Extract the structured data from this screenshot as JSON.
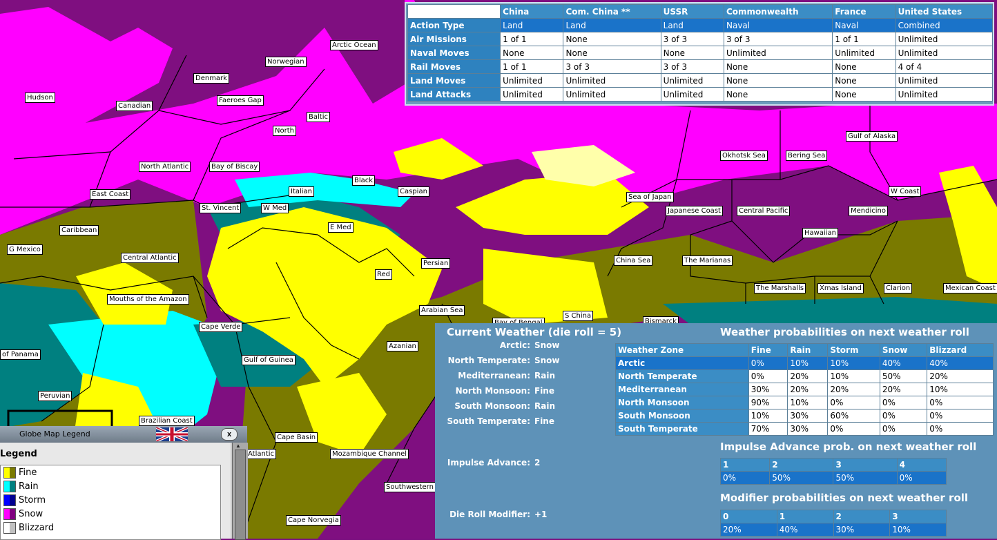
{
  "colors": {
    "fine": "#ffff00",
    "fine_dark": "#7a7a00",
    "rain": "#00ffff",
    "rain_dark": "#008080",
    "storm": "#0000ff",
    "storm_dark": "#000090",
    "snow": "#ff00ff",
    "snow_dark": "#800080",
    "blizzard": "#ffffff",
    "blizzard_dark": "#c0c0c0",
    "panel": "#5e92b8",
    "header": "#3b8dc5",
    "selected": "#1a73c9"
  },
  "map_labels": [
    "Arctic Ocean",
    "Norwegian",
    "Denmark",
    "Hudson",
    "Canadian",
    "Faeroes Gap",
    "Baltic",
    "North",
    "North Atlantic",
    "Bay of Biscay",
    "Black",
    "Caspian",
    "Italian",
    "East Coast",
    "St. Vincent",
    "W Med",
    "E Med",
    "Caribbean",
    "G Mexico",
    "Central Atlantic",
    "Persian",
    "Red",
    "Mouths of the Amazon",
    "Arabian Sea",
    "Cape Verde",
    "Azanian",
    "of Panama",
    "Gulf of Guinea",
    "Peruvian",
    "Brazilian Coast",
    "Cape Basin",
    "Mozambique Channel",
    "Atlantic",
    "Southwestern",
    "Cape Norvegia",
    "Bay of Bengal",
    "S China",
    "Bismarck",
    "Gulf of Alaska",
    "Okhotsk Sea",
    "Bering Sea",
    "W Coast",
    "Sea of Japan",
    "Japanese Coast",
    "Central Pacific",
    "Mendicino",
    "Hawaiian",
    "China Sea",
    "The Marianas",
    "The Marshalls",
    "Xmas Island",
    "Clarion",
    "Mexican Coast"
  ],
  "action_table": {
    "columns": [
      "China",
      "Com. China **",
      "USSR",
      "Commonwealth",
      "France",
      "United States"
    ],
    "rows": [
      {
        "label": "Action Type",
        "cells": [
          "Land",
          "Land",
          "Land",
          "Naval",
          "Naval",
          "Combined"
        ]
      },
      {
        "label": "Air Missions",
        "cells": [
          "1 of 1",
          "None",
          "3 of 3",
          "3 of 3",
          "1 of 1",
          "Unlimited"
        ]
      },
      {
        "label": "Naval Moves",
        "cells": [
          "None",
          "None",
          "None",
          "Unlimited",
          "Unlimited",
          "Unlimited"
        ]
      },
      {
        "label": "Rail Moves",
        "cells": [
          "1 of 1",
          "3 of 3",
          "3 of 3",
          "None",
          "None",
          "4 of 4"
        ]
      },
      {
        "label": "Land Moves",
        "cells": [
          "Unlimited",
          "Unlimited",
          "Unlimited",
          "None",
          "None",
          "Unlimited"
        ]
      },
      {
        "label": "Land Attacks",
        "cells": [
          "Unlimited",
          "Unlimited",
          "Unlimited",
          "None",
          "None",
          "Unlimited"
        ]
      }
    ]
  },
  "weather": {
    "current_title": "Current Weather (die roll = 5)",
    "zones": [
      {
        "label": "Arctic:",
        "value": "Snow"
      },
      {
        "label": "North Temperate:",
        "value": "Snow"
      },
      {
        "label": "Mediterranean:",
        "value": "Rain"
      },
      {
        "label": "North Monsoon:",
        "value": "Fine"
      },
      {
        "label": "South Monsoon:",
        "value": "Rain"
      },
      {
        "label": "South Temperate:",
        "value": "Fine"
      }
    ],
    "impulse_label": "Impulse Advance:",
    "impulse_value": "2",
    "modifier_label": "Die Roll Modifier:",
    "modifier_value": "+1",
    "prob_title": "Weather probabilities on next weather roll",
    "prob_headers": [
      "Weather Zone",
      "Fine",
      "Rain",
      "Storm",
      "Snow",
      "Blizzard"
    ],
    "prob_rows": [
      [
        "Arctic",
        "0%",
        "10%",
        "10%",
        "40%",
        "40%"
      ],
      [
        "North Temperate",
        "0%",
        "20%",
        "10%",
        "50%",
        "20%"
      ],
      [
        "Mediterranean",
        "30%",
        "20%",
        "20%",
        "20%",
        "10%"
      ],
      [
        "North Monsoon",
        "90%",
        "10%",
        "0%",
        "0%",
        "0%"
      ],
      [
        "South Monsoon",
        "10%",
        "30%",
        "60%",
        "0%",
        "0%"
      ],
      [
        "South Temperate",
        "70%",
        "30%",
        "0%",
        "0%",
        "0%"
      ]
    ],
    "impulse_title": "Impulse Advance prob. on next weather roll",
    "impulse_headers": [
      "1",
      "2",
      "3",
      "4"
    ],
    "impulse_values": [
      "0%",
      "50%",
      "50%",
      "0%"
    ],
    "modifier_title": "Modifier probabilities on next weather roll",
    "modifier_headers": [
      "0",
      "1",
      "2",
      "3"
    ],
    "modifier_values": [
      "20%",
      "40%",
      "30%",
      "10%"
    ]
  },
  "legend": {
    "window_title": "Globe Map Legend",
    "heading": "Legend",
    "items": [
      {
        "label": "Fine",
        "icon": "fine-swatch"
      },
      {
        "label": "Rain",
        "icon": "rain-swatch"
      },
      {
        "label": "Storm",
        "icon": "storm-swatch"
      },
      {
        "label": "Snow",
        "icon": "snow-swatch"
      },
      {
        "label": "Blizzard",
        "icon": "blizzard-swatch"
      }
    ],
    "close_label": "x"
  }
}
